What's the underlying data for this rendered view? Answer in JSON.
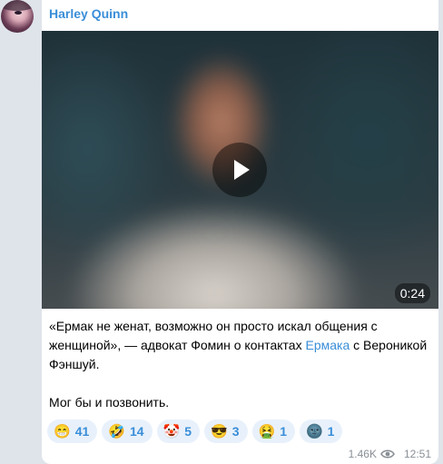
{
  "channel": {
    "author": "Harley Quinn"
  },
  "video": {
    "duration": "0:24"
  },
  "caption": {
    "line1_pre": "«Ермак не женат, возможно он просто искал общения с женщиной», — адвокат Фомин о контактах ",
    "link": "Ермака",
    "line1_post": " с Вероникой Фэншуй.",
    "line2": "Мог бы и позвонить."
  },
  "reactions": [
    {
      "emoji": "😁",
      "icon": "grin-icon",
      "count": "41"
    },
    {
      "emoji": "🤣",
      "icon": "rofl-icon",
      "count": "14"
    },
    {
      "emoji": "🤡",
      "icon": "clown-icon",
      "count": "5"
    },
    {
      "emoji": "😎",
      "icon": "sunglasses-icon",
      "count": "3"
    },
    {
      "emoji": "🤮",
      "icon": "vomit-icon",
      "count": "1"
    },
    {
      "emoji": "🌚",
      "icon": "new-moon-face-icon",
      "count": "1"
    }
  ],
  "meta": {
    "views": "1.46K",
    "time": "12:51"
  },
  "colors": {
    "accent": "#3a8ed8",
    "reaction_bg": "#e8f1fb",
    "page_bg": "#dfe4ea"
  }
}
